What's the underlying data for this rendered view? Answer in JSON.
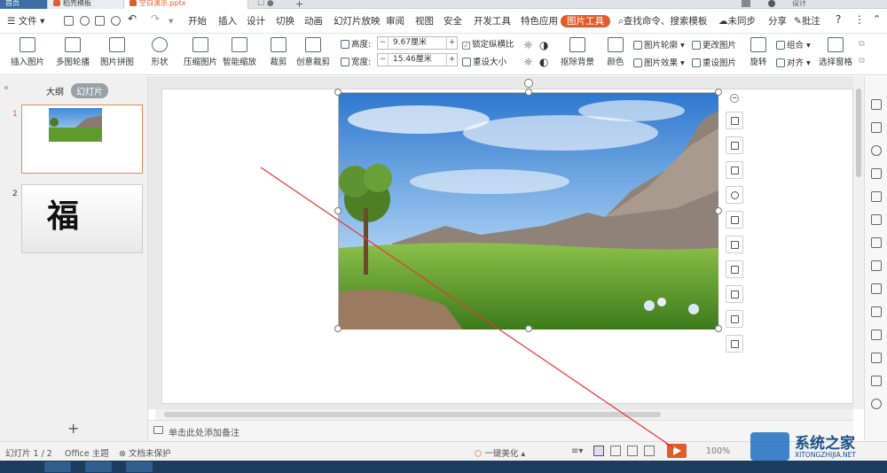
{
  "tabs": [
    {
      "label": "首页"
    },
    {
      "label": "稻壳模板"
    },
    {
      "label": "空白演示.pptx"
    }
  ],
  "tab_right_user": "设计",
  "menu": {
    "file_label": "文件",
    "items": [
      "开始",
      "插入",
      "设计",
      "切换",
      "动画",
      "幻灯片放映",
      "审阅",
      "视图",
      "安全",
      "开发工具",
      "特色应用"
    ],
    "active": "图片工具",
    "search_placeholder": "查找命令、搜索模板",
    "unsync": "未同步",
    "share": "分享",
    "comment": "批注",
    "help": "?"
  },
  "ribbon": {
    "insert_picture": "插入图片",
    "multi_contour": "多图轮播",
    "picture_collage": "图片拼图",
    "shape": "形状",
    "compress": "压缩图片",
    "smart_zoom": "智能缩放",
    "crop": "裁剪",
    "creative_crop": "创意裁剪",
    "height_label": "高度:",
    "height_value": "9.67厘米",
    "width_label": "宽度:",
    "width_value": "15.46厘米",
    "lock_ratio": "锁定纵横比",
    "reset_size": "重设大小",
    "remove_bg": "抠除背景",
    "color": "颜色",
    "pic_outline": "图片轮廓",
    "pic_effect": "图片效果",
    "change_pic": "更改图片",
    "reset_pic": "重设图片",
    "rotate": "旋转",
    "group": "组合",
    "align": "对齐",
    "select_pane": "选择窗格"
  },
  "panel": {
    "outline_tab": "大纲",
    "slides_tab": "幻灯片",
    "slides": [
      {
        "num": "1"
      },
      {
        "num": "2",
        "text": "福"
      }
    ],
    "add": "+"
  },
  "notes_placeholder": "单击此处添加备注",
  "status": {
    "slide_count": "幻灯片 1 / 2",
    "theme": "Office 主题",
    "protection": "文档未保护",
    "beautify": "一键美化",
    "zoom": "100%"
  },
  "watermark": {
    "title": "系统之家",
    "url": "XITONGZHIJIA.NET"
  },
  "colors": {
    "accent": "#e25b2b",
    "annotation_line": "#e53935"
  }
}
